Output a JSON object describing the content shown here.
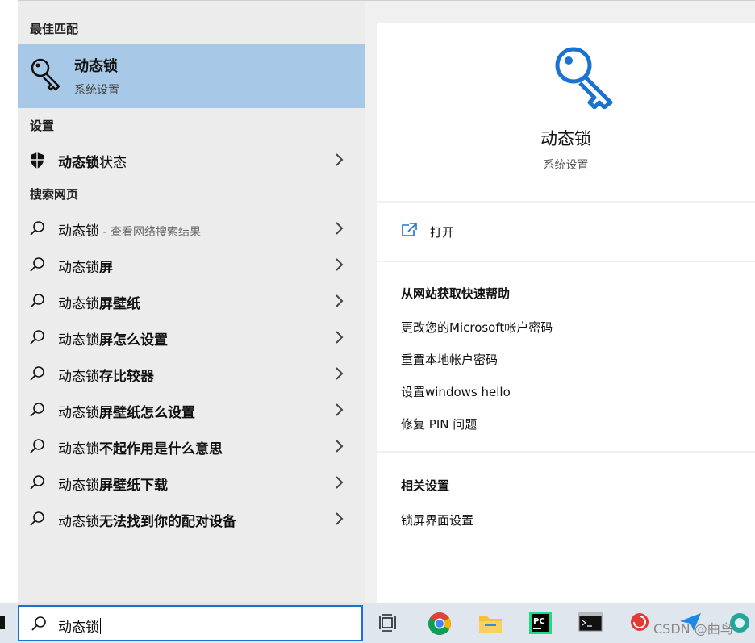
{
  "best_match": {
    "header": "最佳匹配",
    "title": "动态锁",
    "subtitle": "系统设置"
  },
  "settings": {
    "header": "设置",
    "item": {
      "bold": "动态锁",
      "rest": "状态"
    }
  },
  "web": {
    "header": "搜索网页",
    "items": [
      {
        "prefix": "动态锁",
        "bold": "",
        "hint": " - 查看网络搜索结果"
      },
      {
        "prefix": "动态锁",
        "bold": "屏",
        "hint": ""
      },
      {
        "prefix": "动态锁",
        "bold": "屏壁纸",
        "hint": ""
      },
      {
        "prefix": "动态锁",
        "bold": "屏怎么设置",
        "hint": ""
      },
      {
        "prefix": "动态锁",
        "bold": "存比较器",
        "hint": ""
      },
      {
        "prefix": "动态锁",
        "bold": "屏壁纸怎么设置",
        "hint": ""
      },
      {
        "prefix": "动态锁",
        "bold": "不起作用是什么意思",
        "hint": ""
      },
      {
        "prefix": "动态锁",
        "bold": "屏壁纸下载",
        "hint": ""
      },
      {
        "prefix": "动态锁",
        "bold": "无法找到你的配对设备",
        "hint": ""
      }
    ]
  },
  "preview": {
    "title": "动态锁",
    "subtitle": "系统设置",
    "open_label": "打开",
    "help_header": "从网站获取快速帮助",
    "help_links": [
      "更改您的Microsoft帐户密码",
      "重置本地帐户密码",
      "设置windows hello",
      "修复 PIN 问题"
    ],
    "related_header": "相关设置",
    "related_links": [
      "锁屏界面设置"
    ]
  },
  "search": {
    "value": "动态锁"
  },
  "watermark": "CSDN @曲鸟",
  "colors": {
    "accent": "#1a73d0",
    "selected_bg": "#a7c9e7"
  }
}
